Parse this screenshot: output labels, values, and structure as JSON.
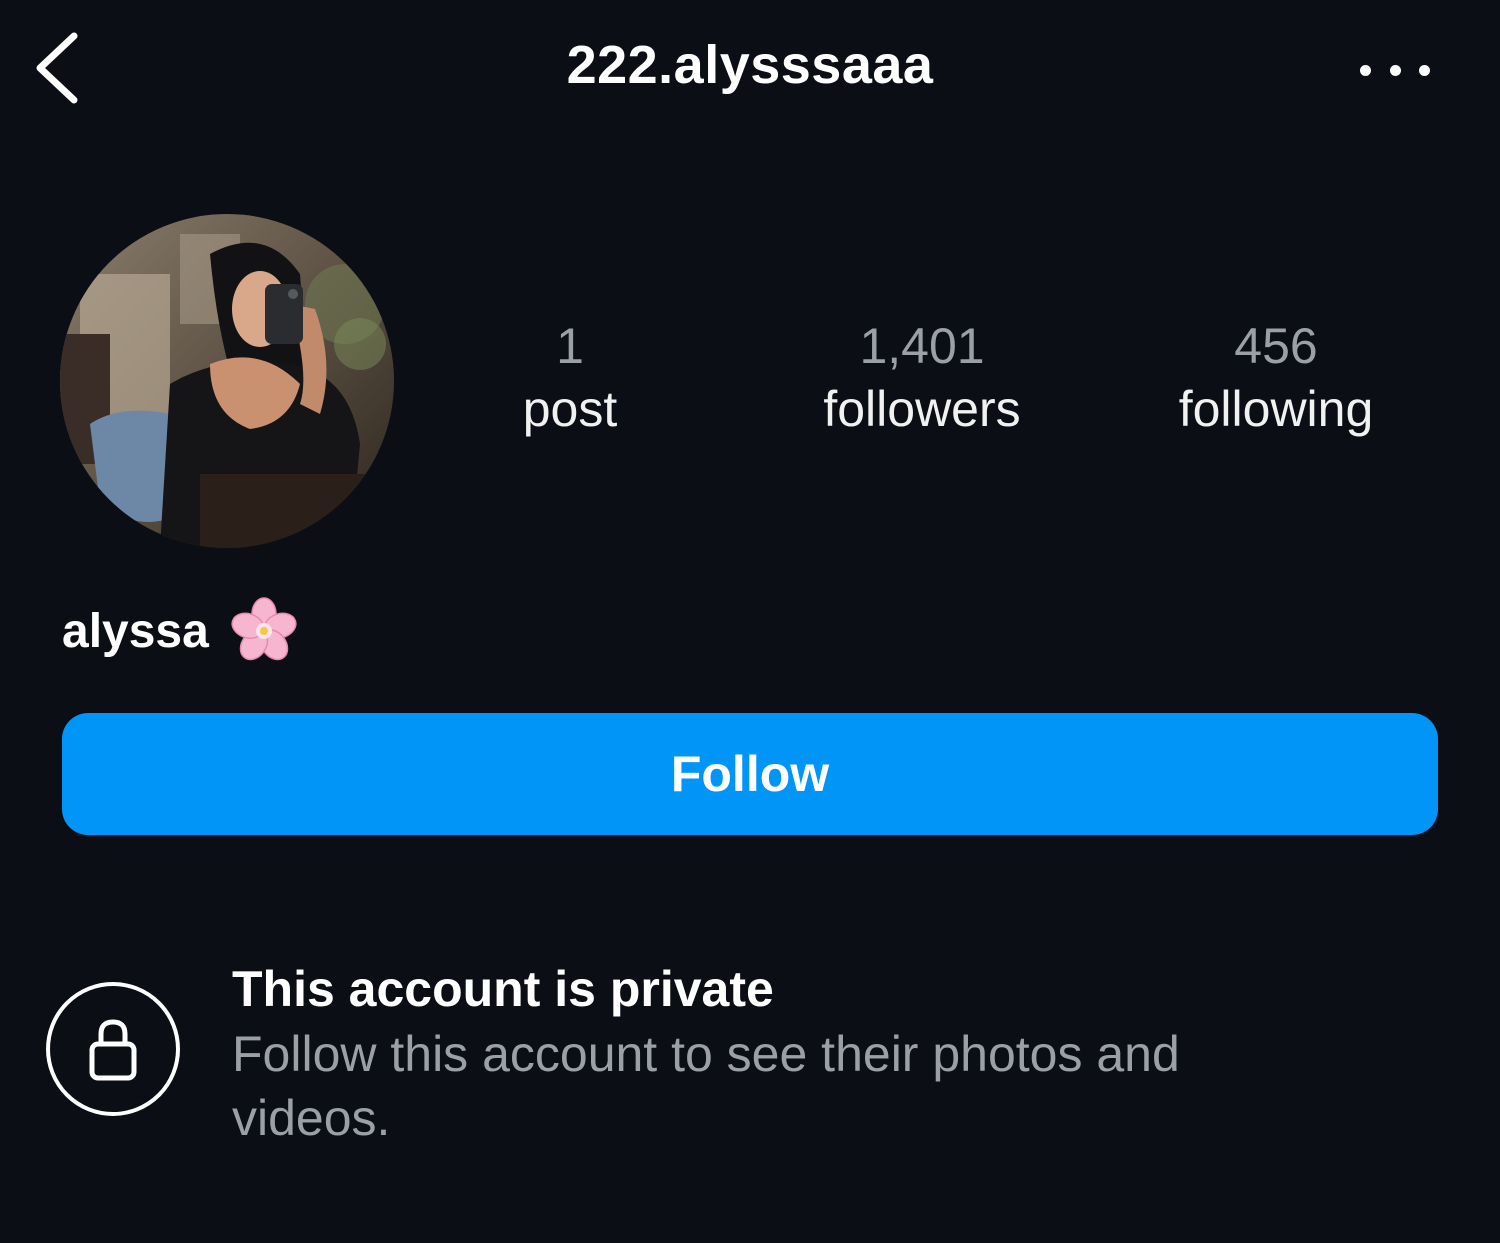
{
  "header": {
    "username": "222.alysssaaa",
    "back_icon": "chevron-left-icon",
    "more_icon": "more-horizontal-icon"
  },
  "profile": {
    "avatar_alt": "profile picture",
    "display_name": "alyssa",
    "name_emoji": "cherry-blossom-icon",
    "stats": {
      "posts": {
        "count": "1",
        "label": "post"
      },
      "followers": {
        "count": "1,401",
        "label": "followers"
      },
      "following": {
        "count": "456",
        "label": "following"
      }
    }
  },
  "actions": {
    "follow_label": "Follow"
  },
  "privacy": {
    "icon": "lock-icon",
    "title": "This account is private",
    "subtitle": "Follow this account to see their photos and videos."
  },
  "colors": {
    "background": "#0b0e14",
    "accent": "#0095f6",
    "muted_text": "#9aa0a6"
  }
}
